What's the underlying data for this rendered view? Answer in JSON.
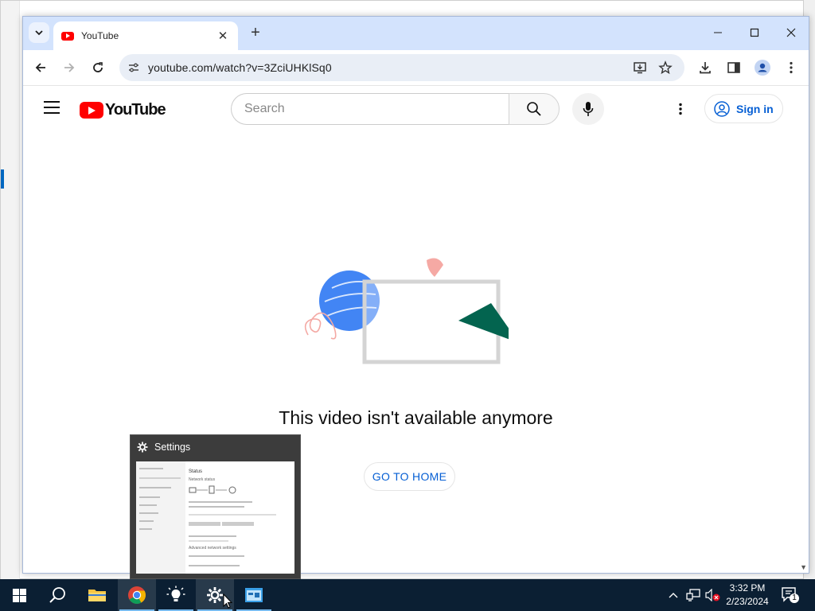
{
  "browser": {
    "tab_title": "YouTube",
    "url": "youtube.com/watch?v=3ZciUHKlSq0"
  },
  "youtube": {
    "logo_text": "YouTube",
    "search_placeholder": "Search",
    "sign_in_label": "Sign in",
    "message": "This video isn't available anymore",
    "go_home_label": "GO TO HOME"
  },
  "preview": {
    "title": "Settings",
    "thumb": {
      "heading": "Status",
      "subheading": "Network status",
      "advanced": "Advanced network settings"
    }
  },
  "taskbar": {
    "time": "3:32 PM",
    "date": "2/23/2024",
    "notification_count": "1",
    "items": [
      "start",
      "search",
      "file-explorer",
      "chrome",
      "tips",
      "settings",
      "app"
    ]
  },
  "colors": {
    "youtube_red": "#ff0000",
    "link_blue": "#065fd4",
    "taskbar": "#0b1f33",
    "tabstrip": "#d3e3fd"
  }
}
